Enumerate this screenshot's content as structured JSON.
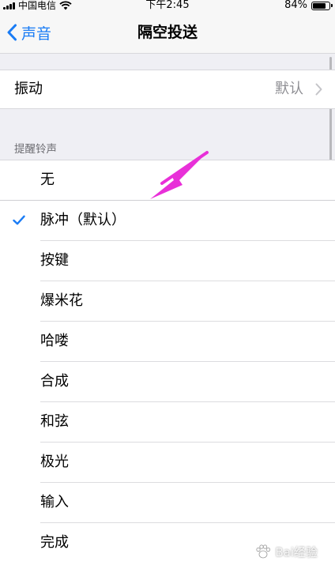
{
  "status_bar": {
    "carrier": "中国电信",
    "time": "下午2:45",
    "battery": "84%",
    "battery_level": 0.84
  },
  "nav": {
    "back_label": "声音",
    "title": "隔空投送"
  },
  "vibration": {
    "label": "振动",
    "value": "默认"
  },
  "section_header": "提醒铃声",
  "tones": [
    {
      "label": "无",
      "selected": false
    },
    {
      "label": "脉冲（默认）",
      "selected": true
    },
    {
      "label": "按键",
      "selected": false
    },
    {
      "label": "爆米花",
      "selected": false
    },
    {
      "label": "哈喽",
      "selected": false
    },
    {
      "label": "合成",
      "selected": false
    },
    {
      "label": "和弦",
      "selected": false
    },
    {
      "label": "极光",
      "selected": false
    },
    {
      "label": "输入",
      "selected": false
    },
    {
      "label": "完成",
      "selected": false
    }
  ],
  "watermark": "Bai经验",
  "colors": {
    "accent": "#1a7cf5",
    "annotation_arrow": "#e830d8",
    "background": "#efeff4"
  }
}
